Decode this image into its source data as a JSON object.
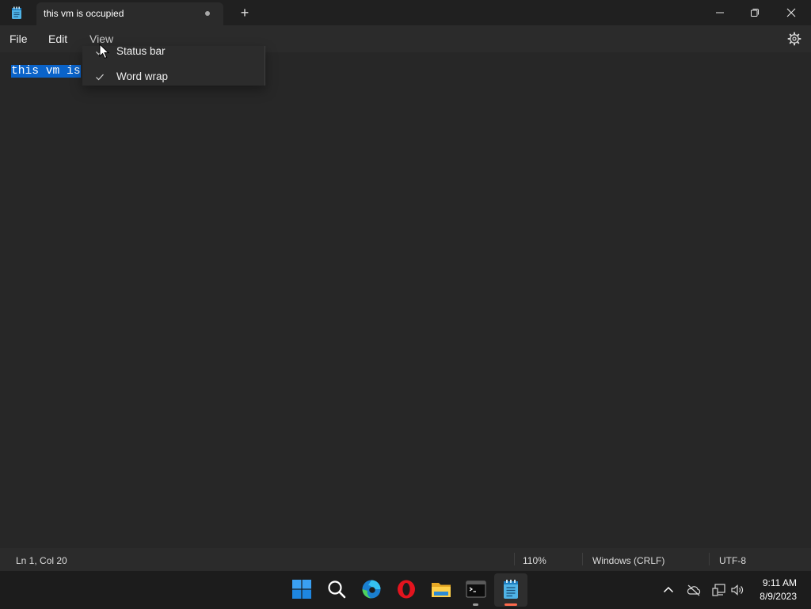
{
  "window": {
    "tab_title": "this vm is occupied",
    "new_tab_symbol": "+",
    "app_icon": "notepad-icon",
    "controls": [
      "minimize-icon",
      "restore-icon",
      "close-icon"
    ]
  },
  "menu": {
    "file": "File",
    "edit": "Edit",
    "view": "View",
    "settings_icon": "gear-icon"
  },
  "view_menu": {
    "items": [
      {
        "label": "Status bar",
        "checked": true
      },
      {
        "label": "Word wrap",
        "checked": true
      }
    ]
  },
  "editor": {
    "selected_text": "this vm is"
  },
  "status": {
    "position": "Ln 1, Col 20",
    "zoom": "110%",
    "line_ending": "Windows (CRLF)",
    "encoding": "UTF-8"
  },
  "taskbar": {
    "apps": [
      "start-icon",
      "search-icon",
      "edge-icon",
      "opera-icon",
      "file-explorer-icon",
      "terminal-icon",
      "notepad-icon"
    ],
    "tray": [
      "chevron-up-icon",
      "onedrive-icon",
      "network-icon",
      "volume-icon"
    ],
    "time": "9:11 AM",
    "date": "8/9/2023"
  },
  "colors": {
    "accent": "#0a63c9",
    "background": "#272727",
    "taskbar_indicator": "#ff6a4d"
  }
}
